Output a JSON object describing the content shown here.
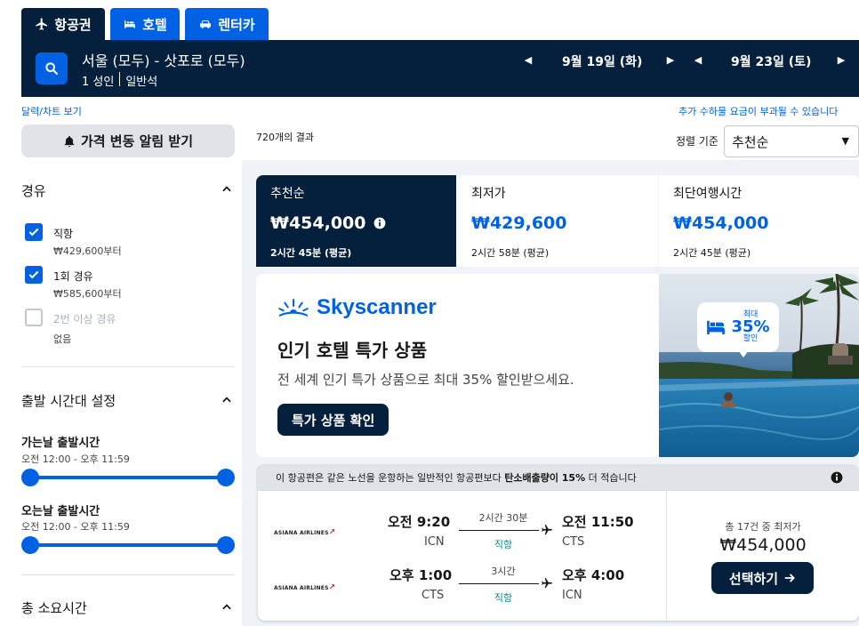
{
  "tabs": [
    {
      "label": "항공권"
    },
    {
      "label": "호텔"
    },
    {
      "label": "렌터카"
    }
  ],
  "search": {
    "route": "서울 (모두) - 삿포로 (모두)",
    "passengers": "1 성인",
    "cabin": "일반석",
    "depart_date": "9월 19일 (화)",
    "return_date": "9월 23일 (토)"
  },
  "links": {
    "calendar": "달력/차트 보기",
    "fees": "추가 수하물 요금이 부과될 수 있습니다"
  },
  "sidebar": {
    "alert_label": "가격 변동 알림 받기",
    "stops_title": "경유",
    "stops": [
      {
        "label": "직항",
        "price": "₩429,600부터",
        "checked": true
      },
      {
        "label": "1회 경유",
        "price": "₩585,600부터",
        "checked": true
      },
      {
        "label": "2번 이상 경유",
        "price": "없음",
        "checked": false
      }
    ],
    "times_title": "출발 시간대 설정",
    "outbound_label": "가는날 출발시간",
    "outbound_range": "오전 12:00 - 오후 11:59",
    "return_label": "오는날 출발시간",
    "return_range": "오전 12:00 - 오후 11:59",
    "duration_title": "총 소요시간"
  },
  "results": {
    "count": "720개의 결과",
    "sort_label": "정렬 기준",
    "sort_value": "추천순"
  },
  "sort_tabs": [
    {
      "title": "추천순",
      "price": "₩454,000",
      "duration": "2시간 45분 (평균)"
    },
    {
      "title": "최저가",
      "price": "₩429,600",
      "duration": "2시간 58분 (평균)"
    },
    {
      "title": "최단여행시간",
      "price": "₩454,000",
      "duration": "2시간 45분 (평균)"
    }
  ],
  "ad": {
    "brand": "Skyscanner",
    "title": "인기 호텔 특가 상품",
    "subtitle": "전 세계 인기 특가 상품으로 최대 35% 할인받으세요.",
    "button": "특가 상품 확인",
    "badge_top": "최대",
    "badge_pct": "35%",
    "badge_bottom": "할인"
  },
  "flight": {
    "carbon_pre": "이 항공편은 같은 노선을 운항하는 일반적인 항공편보다 ",
    "carbon_bold": "탄소배출량이 15%",
    "carbon_post": " 더 적습니다",
    "legs": [
      {
        "airline": "ASIANA AIRLINES",
        "dep_time": "오전 9:20",
        "dep_code": "ICN",
        "duration": "2시간 30분",
        "type": "직항",
        "arr_time": "오전 11:50",
        "arr_code": "CTS"
      },
      {
        "airline": "ASIANA AIRLINES",
        "dep_time": "오후 1:00",
        "dep_code": "CTS",
        "duration": "3시간",
        "type": "직항",
        "arr_time": "오후 4:00",
        "arr_code": "ICN"
      }
    ],
    "deals": "총 17건 중 최저가",
    "price": "₩454,000",
    "select": "선택하기"
  },
  "colors": {
    "navy": "#05203c",
    "blue": "#0062e3",
    "grey": "#e0e4e9"
  }
}
